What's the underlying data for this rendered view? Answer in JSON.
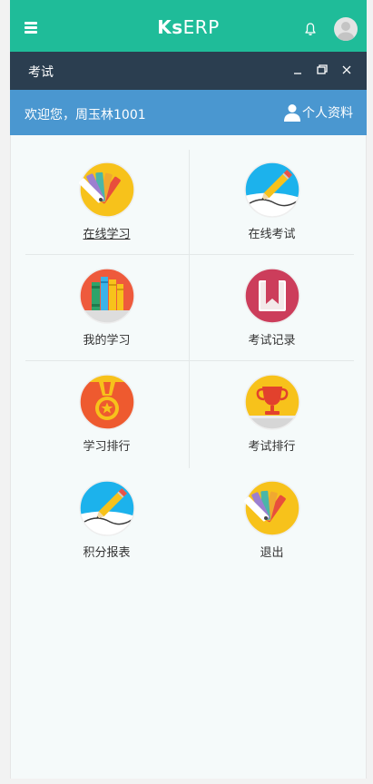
{
  "header": {
    "brand_bold": "Ks",
    "brand_rest": "ERP",
    "icons": [
      "hamburger-menu-icon",
      "bell-icon",
      "user-avatar"
    ]
  },
  "window": {
    "title": "考试",
    "icons": [
      "minimize-icon",
      "restore-icon",
      "close-icon"
    ]
  },
  "welcome": {
    "text": "欢迎您，周玉林1001",
    "profile_label": "个人资料",
    "profile_icon": "user-icon"
  },
  "menu": [
    {
      "label": "在线学习",
      "icon": "color-palette-icon",
      "underlined": true
    },
    {
      "label": "在线考试",
      "icon": "pencil-icon"
    },
    {
      "label": "我的学习",
      "icon": "books-icon"
    },
    {
      "label": "考试记录",
      "icon": "bookmark-icon"
    },
    {
      "label": "学习排行",
      "icon": "medal-icon"
    },
    {
      "label": "考试排行",
      "icon": "trophy-icon"
    },
    {
      "label": "积分报表",
      "icon": "pencil-icon"
    },
    {
      "label": "退出",
      "icon": "color-palette-icon"
    }
  ],
  "colors": {
    "topbar": "#1fbc99",
    "titlebar": "#2b3e50",
    "welcomebar": "#4a97d0",
    "content_bg": "#f5fafa"
  }
}
